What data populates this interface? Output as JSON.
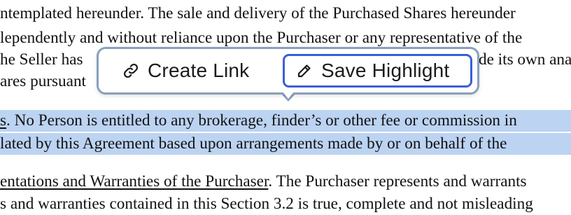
{
  "document": {
    "lines": [
      {
        "text": "ntemplated hereunder. The sale and delivery of the Purchased Shares hereunder",
        "highlighted": false
      },
      {
        "text": "lependently and without reliance upon the Purchaser or any representative of the",
        "highlighted": false
      },
      {
        "text": "he Seller has",
        "highlighted": false,
        "right_text": "de its own analysis"
      },
      {
        "text": "ares pursuant",
        "highlighted": false
      },
      {
        "underlined": "s",
        "text": ". No Person is entitled to any brokerage, finder’s or other fee or commission in",
        "highlighted": true
      },
      {
        "text": "lated by this Agreement based upon arrangements made by or on behalf of the",
        "highlighted": true
      },
      {
        "underlined": "entations and Warranties of the Purchaser",
        "text": ". The Purchaser represents and warrants",
        "highlighted": false
      },
      {
        "text": "s and warranties contained in this Section 3.2 is true, complete and not misleading",
        "highlighted": false
      }
    ]
  },
  "popup": {
    "create_link": {
      "label": "Create Link",
      "icon": "link-icon"
    },
    "save_highlight": {
      "label": "Save Highlight",
      "icon": "pencil-icon",
      "focused": true
    }
  },
  "colors": {
    "highlight": "#bcd3f2",
    "focus_ring": "#3c5fd6",
    "popup_border": "#8aa0bd"
  }
}
